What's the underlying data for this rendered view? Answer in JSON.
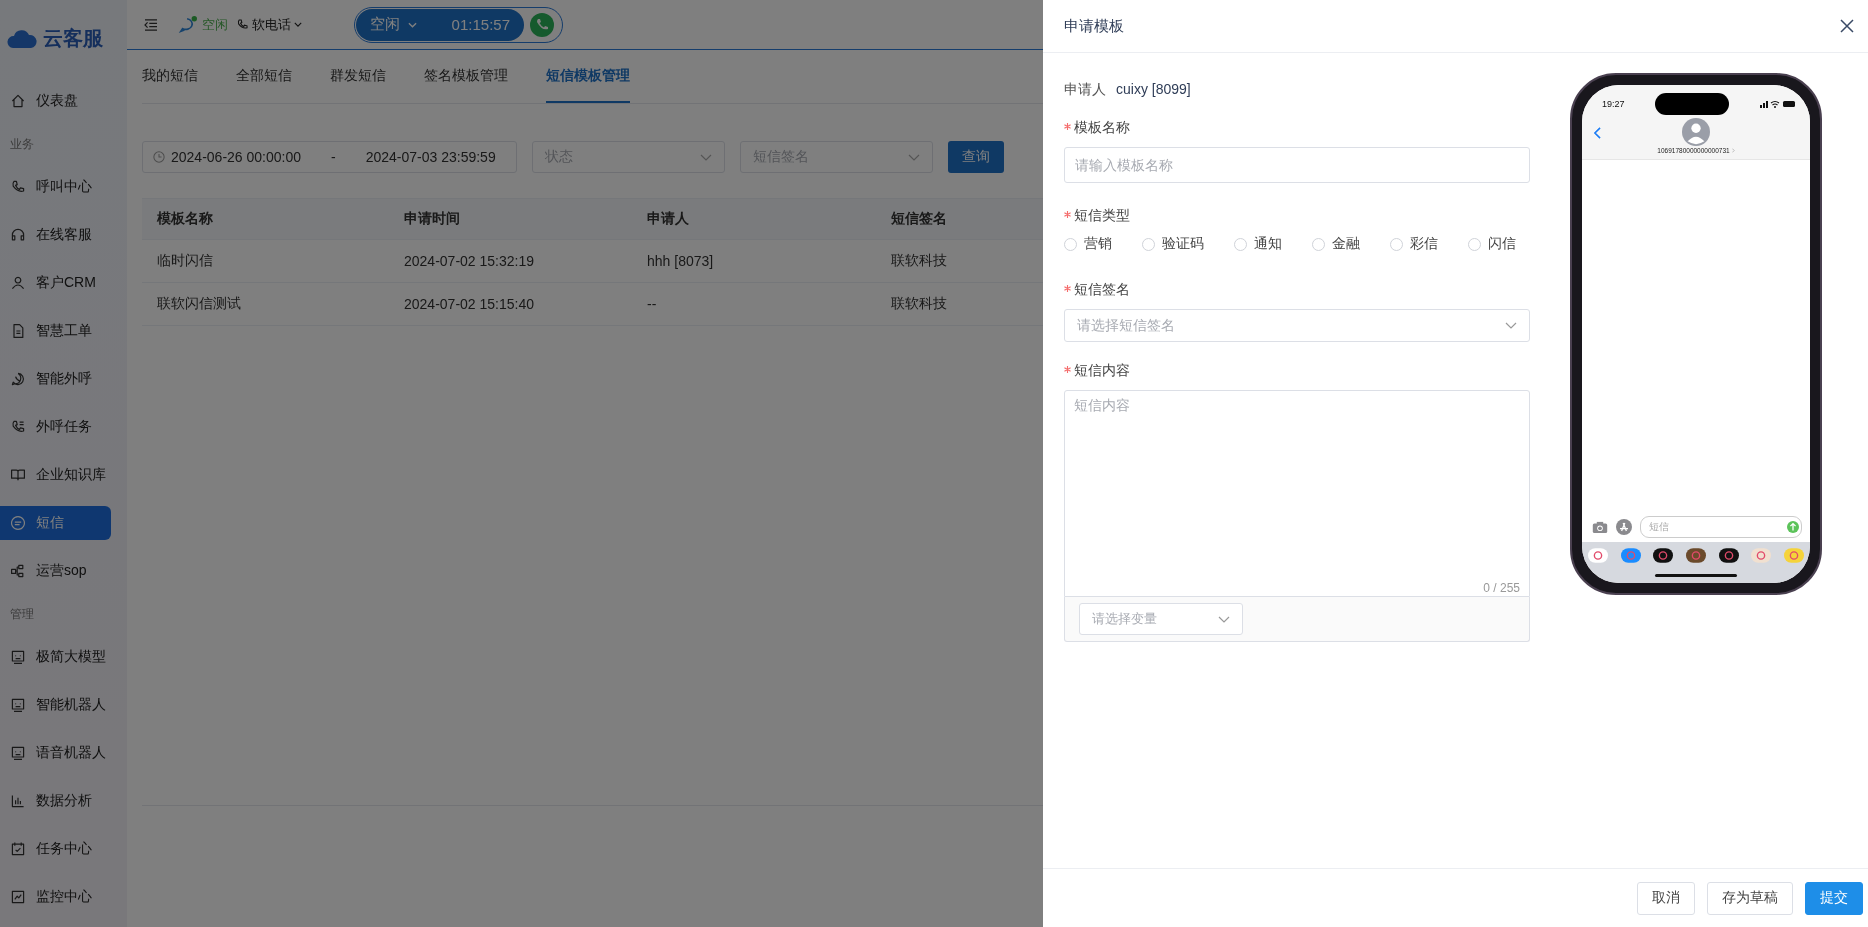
{
  "sidebar": {
    "logo": "云客服",
    "items": [
      {
        "kind": "item",
        "label": "仪表盘",
        "selected": false
      },
      {
        "kind": "section",
        "label": "业务"
      },
      {
        "kind": "item",
        "label": "呼叫中心",
        "selected": false
      },
      {
        "kind": "item",
        "label": "在线客服",
        "selected": false
      },
      {
        "kind": "item",
        "label": "客户CRM",
        "selected": false
      },
      {
        "kind": "item",
        "label": "智慧工单",
        "selected": false
      },
      {
        "kind": "item",
        "label": "智能外呼",
        "selected": false
      },
      {
        "kind": "item",
        "label": "外呼任务",
        "selected": false
      },
      {
        "kind": "item",
        "label": "企业知识库",
        "selected": false
      },
      {
        "kind": "item",
        "label": "短信",
        "selected": true
      },
      {
        "kind": "item",
        "label": "运营sop",
        "selected": false
      },
      {
        "kind": "section",
        "label": "管理"
      },
      {
        "kind": "item",
        "label": "极简大模型",
        "selected": false
      },
      {
        "kind": "item",
        "label": "智能机器人",
        "selected": false
      },
      {
        "kind": "item",
        "label": "语音机器人",
        "selected": false
      },
      {
        "kind": "item",
        "label": "数据分析",
        "selected": false
      },
      {
        "kind": "item",
        "label": "任务中心",
        "selected": false
      },
      {
        "kind": "item",
        "label": "监控中心",
        "selected": false
      }
    ]
  },
  "topbar": {
    "agent_status": "空闲",
    "phone_mode": "软电话",
    "call_status": "空闲",
    "timer": "01:15:57"
  },
  "tabs": [
    {
      "label": "我的短信",
      "selected": false
    },
    {
      "label": "全部短信",
      "selected": false
    },
    {
      "label": "群发短信",
      "selected": false
    },
    {
      "label": "签名模板管理",
      "selected": false
    },
    {
      "label": "短信模板管理",
      "selected": true
    }
  ],
  "filters": {
    "date_start": "2024-06-26 00:00:00",
    "date_separator": "-",
    "date_end": "2024-07-03 23:59:59",
    "status_placeholder": "状态",
    "signature_placeholder": "短信签名",
    "query_button": "查询"
  },
  "table": {
    "columns": [
      "模板名称",
      "申请时间",
      "申请人",
      "短信签名"
    ],
    "rows": [
      [
        "临时闪信",
        "2024-07-02 15:32:19",
        "hhh [8073]",
        "联软科技"
      ],
      [
        "联软闪信测试",
        "2024-07-02 15:15:40",
        "--",
        "联软科技"
      ]
    ]
  },
  "drawer": {
    "title": "申请模板",
    "applicant_label": "申请人",
    "applicant": "cuixy [8099]",
    "name_field": {
      "label": "模板名称",
      "required": true,
      "placeholder": "请输入模板名称"
    },
    "type_field": {
      "label": "短信类型",
      "required": true,
      "options": [
        {
          "label": "营销",
          "selected": false
        },
        {
          "label": "验证码",
          "selected": false
        },
        {
          "label": "通知",
          "selected": false
        },
        {
          "label": "金融",
          "selected": false
        },
        {
          "label": "彩信",
          "selected": false
        },
        {
          "label": "闪信",
          "selected": false
        }
      ]
    },
    "signature_field": {
      "label": "短信签名",
      "required": true,
      "placeholder": "请选择短信签名"
    },
    "content_field": {
      "label": "短信内容",
      "required": true,
      "placeholder": "短信内容",
      "counter": "0 / 255",
      "variable_placeholder": "请选择变量"
    },
    "phone_preview": {
      "time": "19:27",
      "sender": "10691780000000000731",
      "input_placeholder": "短信"
    },
    "buttons": [
      {
        "label": "取消",
        "kind": "default"
      },
      {
        "label": "存为草稿",
        "kind": "default"
      },
      {
        "label": "提交",
        "kind": "primary"
      }
    ]
  }
}
